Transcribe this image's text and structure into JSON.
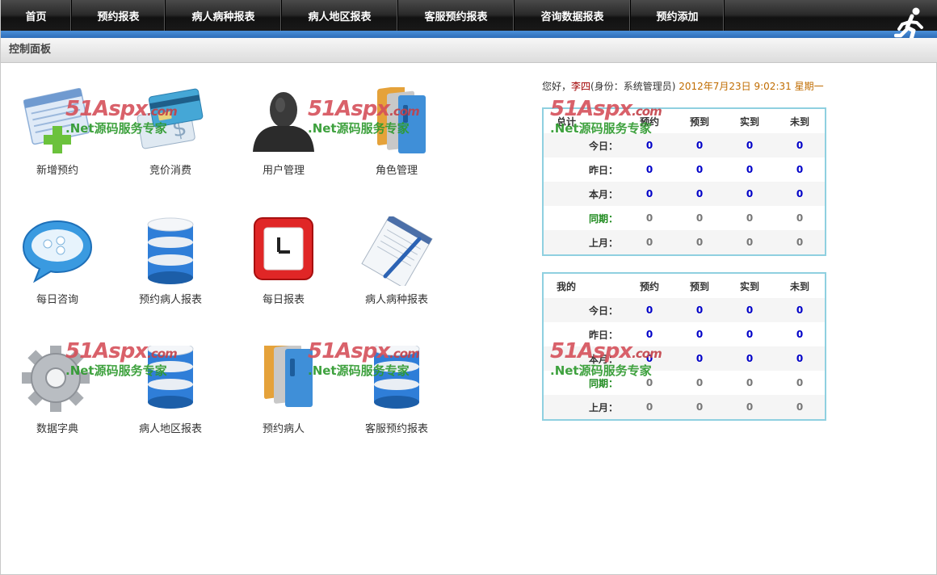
{
  "nav": {
    "items": [
      "首页",
      "预约报表",
      "病人病种报表",
      "病人地区报表",
      "客服预约报表",
      "咨询数据报表",
      "预约添加"
    ]
  },
  "panel": {
    "title": "控制面板"
  },
  "tiles": [
    {
      "label": "新增预约",
      "icon": "add-appointment-icon"
    },
    {
      "label": "竞价消费",
      "icon": "bid-cost-icon"
    },
    {
      "label": "用户管理",
      "icon": "user-icon"
    },
    {
      "label": "角色管理",
      "icon": "folders-icon"
    },
    {
      "label": "每日咨询",
      "icon": "chat-icon"
    },
    {
      "label": "预约病人报表",
      "icon": "database-icon"
    },
    {
      "label": "每日报表",
      "icon": "clock-icon"
    },
    {
      "label": "病人病种报表",
      "icon": "document-pen-icon"
    },
    {
      "label": "数据字典",
      "icon": "gear-icon"
    },
    {
      "label": "病人地区报表",
      "icon": "database-icon"
    },
    {
      "label": "预约病人",
      "icon": "folders-icon"
    },
    {
      "label": "客服预约报表",
      "icon": "database-icon"
    }
  ],
  "watermark": {
    "brand": "51Aspx",
    "tld": ".com",
    "sub": ".Net源码服务专家"
  },
  "greeting": {
    "hello": "您好，",
    "name": "李四",
    "role": "(身份：系统管理员)",
    "time": "2012年7月23日 9:02:31 星期一"
  },
  "tables": [
    {
      "title": "总计",
      "headers": [
        "预约",
        "预到",
        "实到",
        "未到"
      ],
      "rows": [
        {
          "label": "今日：",
          "values": [
            "0",
            "0",
            "0",
            "0"
          ],
          "style": "blue"
        },
        {
          "label": "昨日：",
          "values": [
            "0",
            "0",
            "0",
            "0"
          ],
          "style": "blue"
        },
        {
          "label": "本月：",
          "values": [
            "0",
            "0",
            "0",
            "0"
          ],
          "style": "blue"
        },
        {
          "label": "同期：",
          "values": [
            "0",
            "0",
            "0",
            "0"
          ],
          "style": "gray",
          "labelColor": "green"
        },
        {
          "label": "上月：",
          "values": [
            "0",
            "0",
            "0",
            "0"
          ],
          "style": "gray"
        }
      ]
    },
    {
      "title": "我的",
      "headers": [
        "预约",
        "预到",
        "实到",
        "未到"
      ],
      "rows": [
        {
          "label": "今日：",
          "values": [
            "0",
            "0",
            "0",
            "0"
          ],
          "style": "blue"
        },
        {
          "label": "昨日：",
          "values": [
            "0",
            "0",
            "0",
            "0"
          ],
          "style": "blue"
        },
        {
          "label": "本月：",
          "values": [
            "0",
            "0",
            "0",
            "0"
          ],
          "style": "blue"
        },
        {
          "label": "同期：",
          "values": [
            "0",
            "0",
            "0",
            "0"
          ],
          "style": "gray",
          "labelColor": "green"
        },
        {
          "label": "上月：",
          "values": [
            "0",
            "0",
            "0",
            "0"
          ],
          "style": "gray"
        }
      ]
    }
  ]
}
